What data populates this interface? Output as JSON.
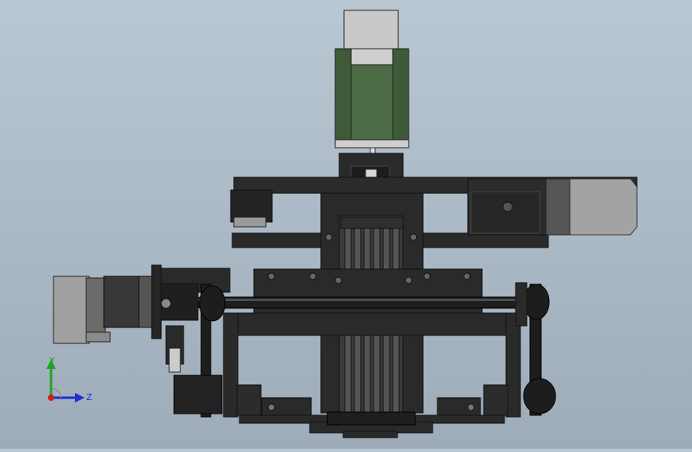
{
  "viewport": {
    "background_top": "#b9c7d3",
    "background_bottom": "#9eacb9",
    "model_colors": {
      "steel": "#2a2a2a",
      "edge": "#101010",
      "motor_body": "#4a6b44",
      "motor_cap": "#c8c8c8",
      "screw": "#3a3a3a"
    }
  },
  "triad": {
    "y_label": "Y",
    "z_label": "Z",
    "y_color": "#1fa51f",
    "z_color": "#1f2fd0",
    "x_color": "#d01f1f"
  },
  "parts": {
    "top_motor": "stepper-motor-icon",
    "left_motor": "stepper-motor-icon",
    "right_motor": "stepper-motor-icon",
    "lead_screw": "lead-screw-icon",
    "shaft": "shaft-icon",
    "pulleys": "pulley-icon"
  }
}
